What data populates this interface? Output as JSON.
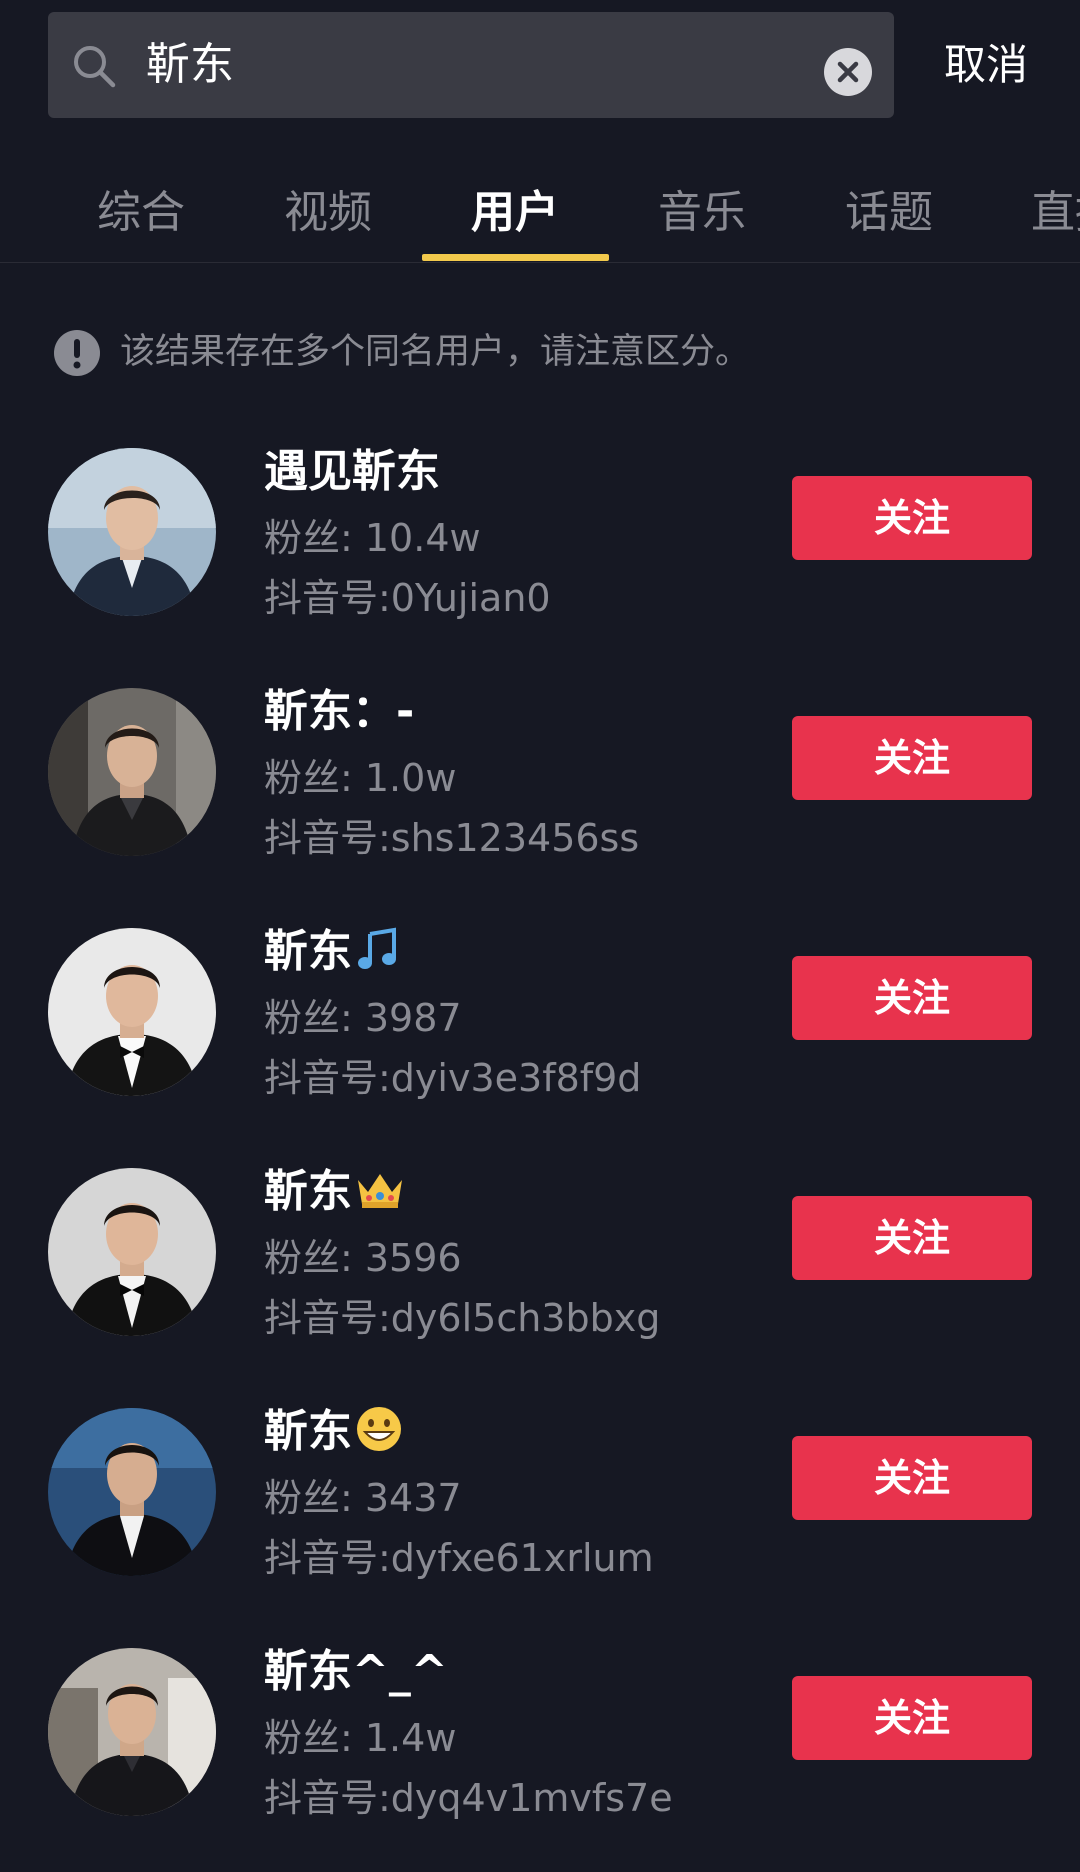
{
  "search": {
    "query": "靳东",
    "cancel_label": "取消"
  },
  "tabs": [
    {
      "label": "综合"
    },
    {
      "label": "视频"
    },
    {
      "label": "用户"
    },
    {
      "label": "音乐"
    },
    {
      "label": "话题"
    },
    {
      "label": "直播"
    }
  ],
  "active_tab": "用户",
  "notice": {
    "text": "该结果存在多个同名用户，请注意区分。"
  },
  "users": [
    {
      "name": "遇见靳东",
      "emoji": "",
      "fans": "粉丝: 10.4w",
      "douyin_id": "抖音号:0Yujian0",
      "follow_label": "关注"
    },
    {
      "name": "靳东：-",
      "emoji": "",
      "fans": "粉丝: 1.0w",
      "douyin_id": "抖音号:shs123456ss",
      "follow_label": "关注"
    },
    {
      "name": "靳东",
      "emoji": "music-note-icon",
      "fans": "粉丝: 3987",
      "douyin_id": "抖音号:dyiv3e3f8f9d",
      "follow_label": "关注"
    },
    {
      "name": "靳东",
      "emoji": "crown-icon",
      "fans": "粉丝: 3596",
      "douyin_id": "抖音号:dy6l5ch3bbxg",
      "follow_label": "关注"
    },
    {
      "name": "靳东",
      "emoji": "grinning-face-icon",
      "fans": "粉丝: 3437",
      "douyin_id": "抖音号:dyfxe61xrlum",
      "follow_label": "关注"
    },
    {
      "name": "靳东^_^",
      "emoji": "",
      "fans": "粉丝: 1.4w",
      "douyin_id": "抖音号:dyq4v1mvfs7e",
      "follow_label": "关注"
    }
  ],
  "colors": {
    "background": "#161823",
    "search_box": "#3a3b44",
    "follow_button": "#e8334d",
    "tab_indicator": "#f2c94c",
    "secondary_text": "#8a8b93"
  }
}
